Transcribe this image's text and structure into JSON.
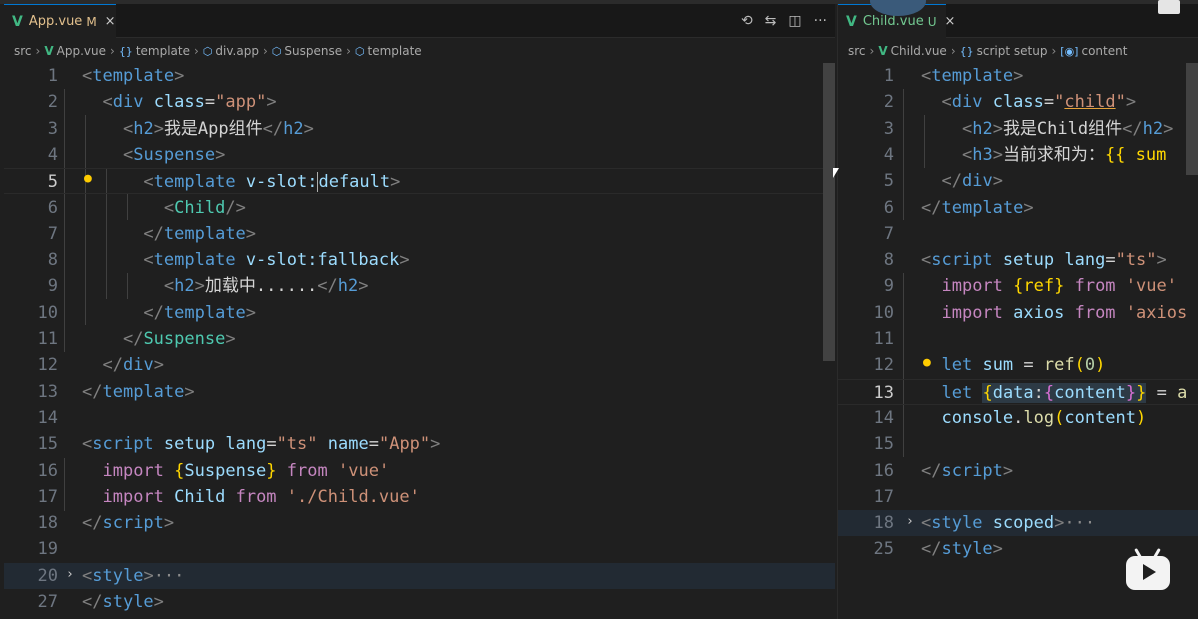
{
  "left": {
    "tab": {
      "name": "App.vue",
      "badge": "M",
      "close": "×"
    },
    "breadcrumb": [
      "src",
      "App.vue",
      "template",
      "div.app",
      "Suspense",
      "template"
    ],
    "lines": [
      {
        "n": "1"
      },
      {
        "n": "2"
      },
      {
        "n": "3"
      },
      {
        "n": "4"
      },
      {
        "n": "5"
      },
      {
        "n": "6"
      },
      {
        "n": "7"
      },
      {
        "n": "8"
      },
      {
        "n": "9"
      },
      {
        "n": "10"
      },
      {
        "n": "11"
      },
      {
        "n": "12"
      },
      {
        "n": "13"
      },
      {
        "n": "14"
      },
      {
        "n": "15"
      },
      {
        "n": "16"
      },
      {
        "n": "17"
      },
      {
        "n": "18"
      },
      {
        "n": "19"
      },
      {
        "n": "20"
      },
      {
        "n": "27"
      }
    ],
    "code": {
      "template": "template",
      "div": "div",
      "class_attr": "class",
      "app_val": "\"app\"",
      "h2": "h2",
      "h2_text": "我是App组件",
      "suspense": "Suspense",
      "vslot": "v-slot:",
      "default": "default",
      "child": "Child",
      "fallback": "v-slot:fallback",
      "loading": "加载中......",
      "script": "script",
      "setup": "setup",
      "lang": "lang",
      "ts": "\"ts\"",
      "name_attr": "name",
      "app_name": "\"App\"",
      "import": "import",
      "suspense_import": "Suspense",
      "from": "from",
      "vue_str": "'vue'",
      "child_import": "Child",
      "child_path": "'./Child.vue'",
      "style": "style",
      "ellipsis": "···"
    }
  },
  "right": {
    "tab": {
      "name": "Child.vue",
      "badge": "U",
      "close": "×"
    },
    "breadcrumb": [
      "src",
      "Child.vue",
      "script setup",
      "content"
    ],
    "lines": [
      {
        "n": "1"
      },
      {
        "n": "2"
      },
      {
        "n": "3"
      },
      {
        "n": "4"
      },
      {
        "n": "5"
      },
      {
        "n": "6"
      },
      {
        "n": "7"
      },
      {
        "n": "8"
      },
      {
        "n": "9"
      },
      {
        "n": "10"
      },
      {
        "n": "11"
      },
      {
        "n": "12"
      },
      {
        "n": "13"
      },
      {
        "n": "14"
      },
      {
        "n": "15"
      },
      {
        "n": "16"
      },
      {
        "n": "17"
      },
      {
        "n": "18"
      },
      {
        "n": "25"
      }
    ],
    "code": {
      "child_val_open": "\"",
      "child_val": "child",
      "child_val_close": "\"",
      "h2_text": "我是Child组件",
      "h3": "h3",
      "h3_text": "当前求和为：",
      "sum_expr": "{{ sum",
      "ref_import": "{ref}",
      "axios": "axios",
      "axios_str": "'axios",
      "let": "let",
      "sum": "sum",
      "eq": "=",
      "ref_call": "ref",
      "zero": "0",
      "data_key": "data",
      "content": "content",
      "tail_a": "a",
      "console": "console",
      "log": "log",
      "scoped": "scoped"
    }
  },
  "colors": {
    "accent": "#0078d4",
    "modified": "#e2c08d",
    "untracked": "#73c991",
    "vue": "#41b883"
  },
  "icons": [
    "vue-icon",
    "timeline-icon",
    "compare-icon",
    "split-editor-icon",
    "more-icon",
    "braces-icon",
    "cube-icon",
    "variable-icon",
    "lightbulb-icon",
    "chevron-right-icon",
    "bilibili-icon"
  ]
}
